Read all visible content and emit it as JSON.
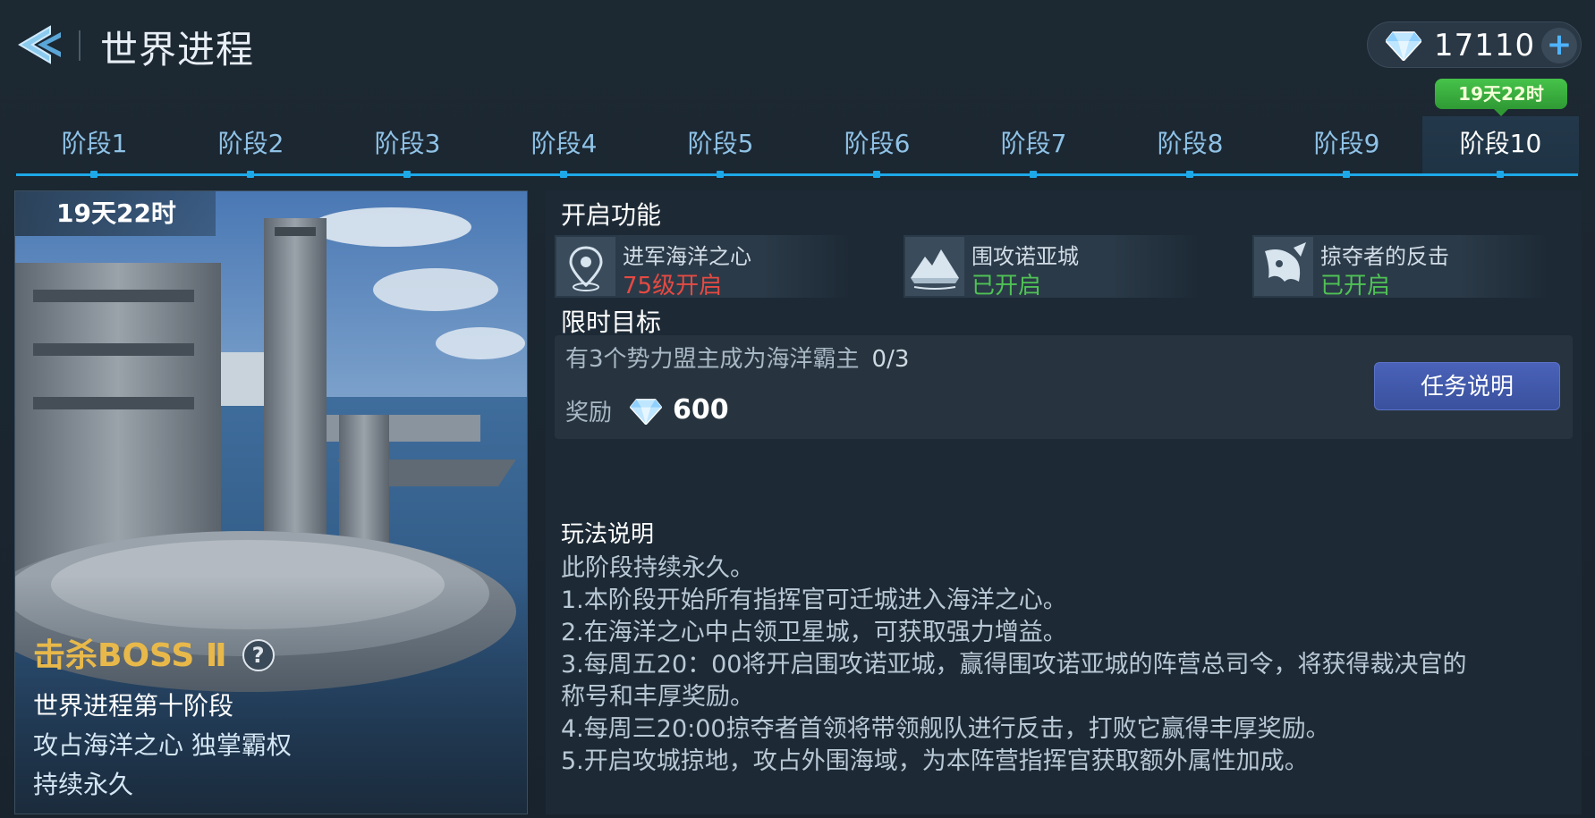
{
  "header": {
    "title": "世界进程",
    "currency_value": "17110",
    "add_symbol": "+",
    "timer_bubble": "19天22时"
  },
  "tabs": [
    {
      "label": "阶段1"
    },
    {
      "label": "阶段2"
    },
    {
      "label": "阶段3"
    },
    {
      "label": "阶段4"
    },
    {
      "label": "阶段5"
    },
    {
      "label": "阶段6"
    },
    {
      "label": "阶段7"
    },
    {
      "label": "阶段8"
    },
    {
      "label": "阶段9"
    },
    {
      "label": "阶段10"
    }
  ],
  "active_tab": "阶段10",
  "stage_card": {
    "timer": "19天22时",
    "boss_title": "击杀BOSS Ⅱ",
    "help_symbol": "?",
    "stage_name": "世界进程第十阶段",
    "line1": "攻占海洋之心 独掌霸权",
    "line2": "持续永久"
  },
  "features": {
    "title": "开启功能",
    "items": [
      {
        "name": "进军海洋之心",
        "status": "75级开启",
        "state": "locked",
        "icon": "location-pin-icon"
      },
      {
        "name": "围攻诺亚城",
        "status": "已开启",
        "state": "open",
        "icon": "mountain-icon"
      },
      {
        "name": "掠夺者的反击",
        "status": "已开启",
        "state": "open",
        "icon": "raider-icon"
      }
    ]
  },
  "goal": {
    "title": "限时目标",
    "text": "有3个势力盟主成为海洋霸主",
    "progress": "0/3",
    "reward_label": "奖励",
    "reward_value": "600",
    "button": "任务说明"
  },
  "rules": {
    "title": "玩法说明",
    "lines": [
      "此阶段持续永久。",
      "1.本阶段开始所有指挥官可迁城进入海洋之心。",
      "2.在海洋之心中占领卫星城，可获取强力增益。",
      "3.每周五20：00将开启围攻诺亚城，赢得围攻诺亚城的阵营总司令，将获得裁决官的",
      "称号和丰厚奖励。",
      "4.每周三20:00掠夺者首领将带领舰队进行反击，打败它赢得丰厚奖励。",
      "5.开启攻城掠地，攻占外围海域，为本阵营指挥官获取额外属性加成。"
    ]
  },
  "colors": {
    "accent_blue": "#1da8e8",
    "locked_red": "#e54a43",
    "open_green": "#4fc255",
    "boss_gold": "#e8b94a",
    "button_blue": "#4a62b8"
  }
}
